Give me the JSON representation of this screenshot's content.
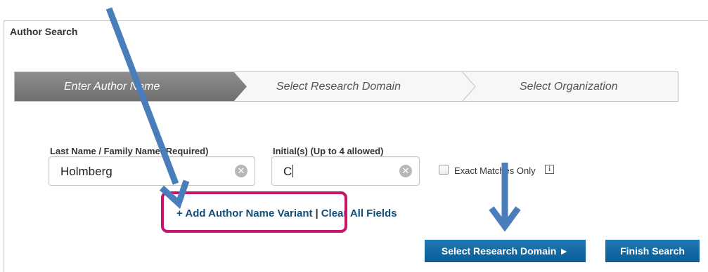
{
  "panel": {
    "title": "Author Search"
  },
  "steps": [
    {
      "label": "Enter Author Name",
      "active": true
    },
    {
      "label": "Select Research Domain",
      "active": false
    },
    {
      "label": "Select Organization",
      "active": false
    }
  ],
  "form": {
    "last_name": {
      "label": "Last Name / Family Name  (Required)",
      "value": "Holmberg"
    },
    "initials": {
      "label": "Initial(s)  (Up to 4 allowed)",
      "value": "C"
    },
    "exact_matches": {
      "label": "Exact Matches Only",
      "checked": false,
      "info_icon": "info-icon"
    },
    "clear_icon": "clear-x-icon"
  },
  "links": {
    "add_variant": "+ Add Author Name Variant",
    "separator": "|",
    "clear_all": "Clear All Fields"
  },
  "buttons": {
    "research_domain": "Select Research Domain ►",
    "finish": "Finish Search"
  },
  "colors": {
    "accent_blue": "#1f78b4",
    "arrow_blue": "#4a7ebb",
    "highlight_magenta": "#c4176c",
    "active_step": "#7a7a7a"
  }
}
